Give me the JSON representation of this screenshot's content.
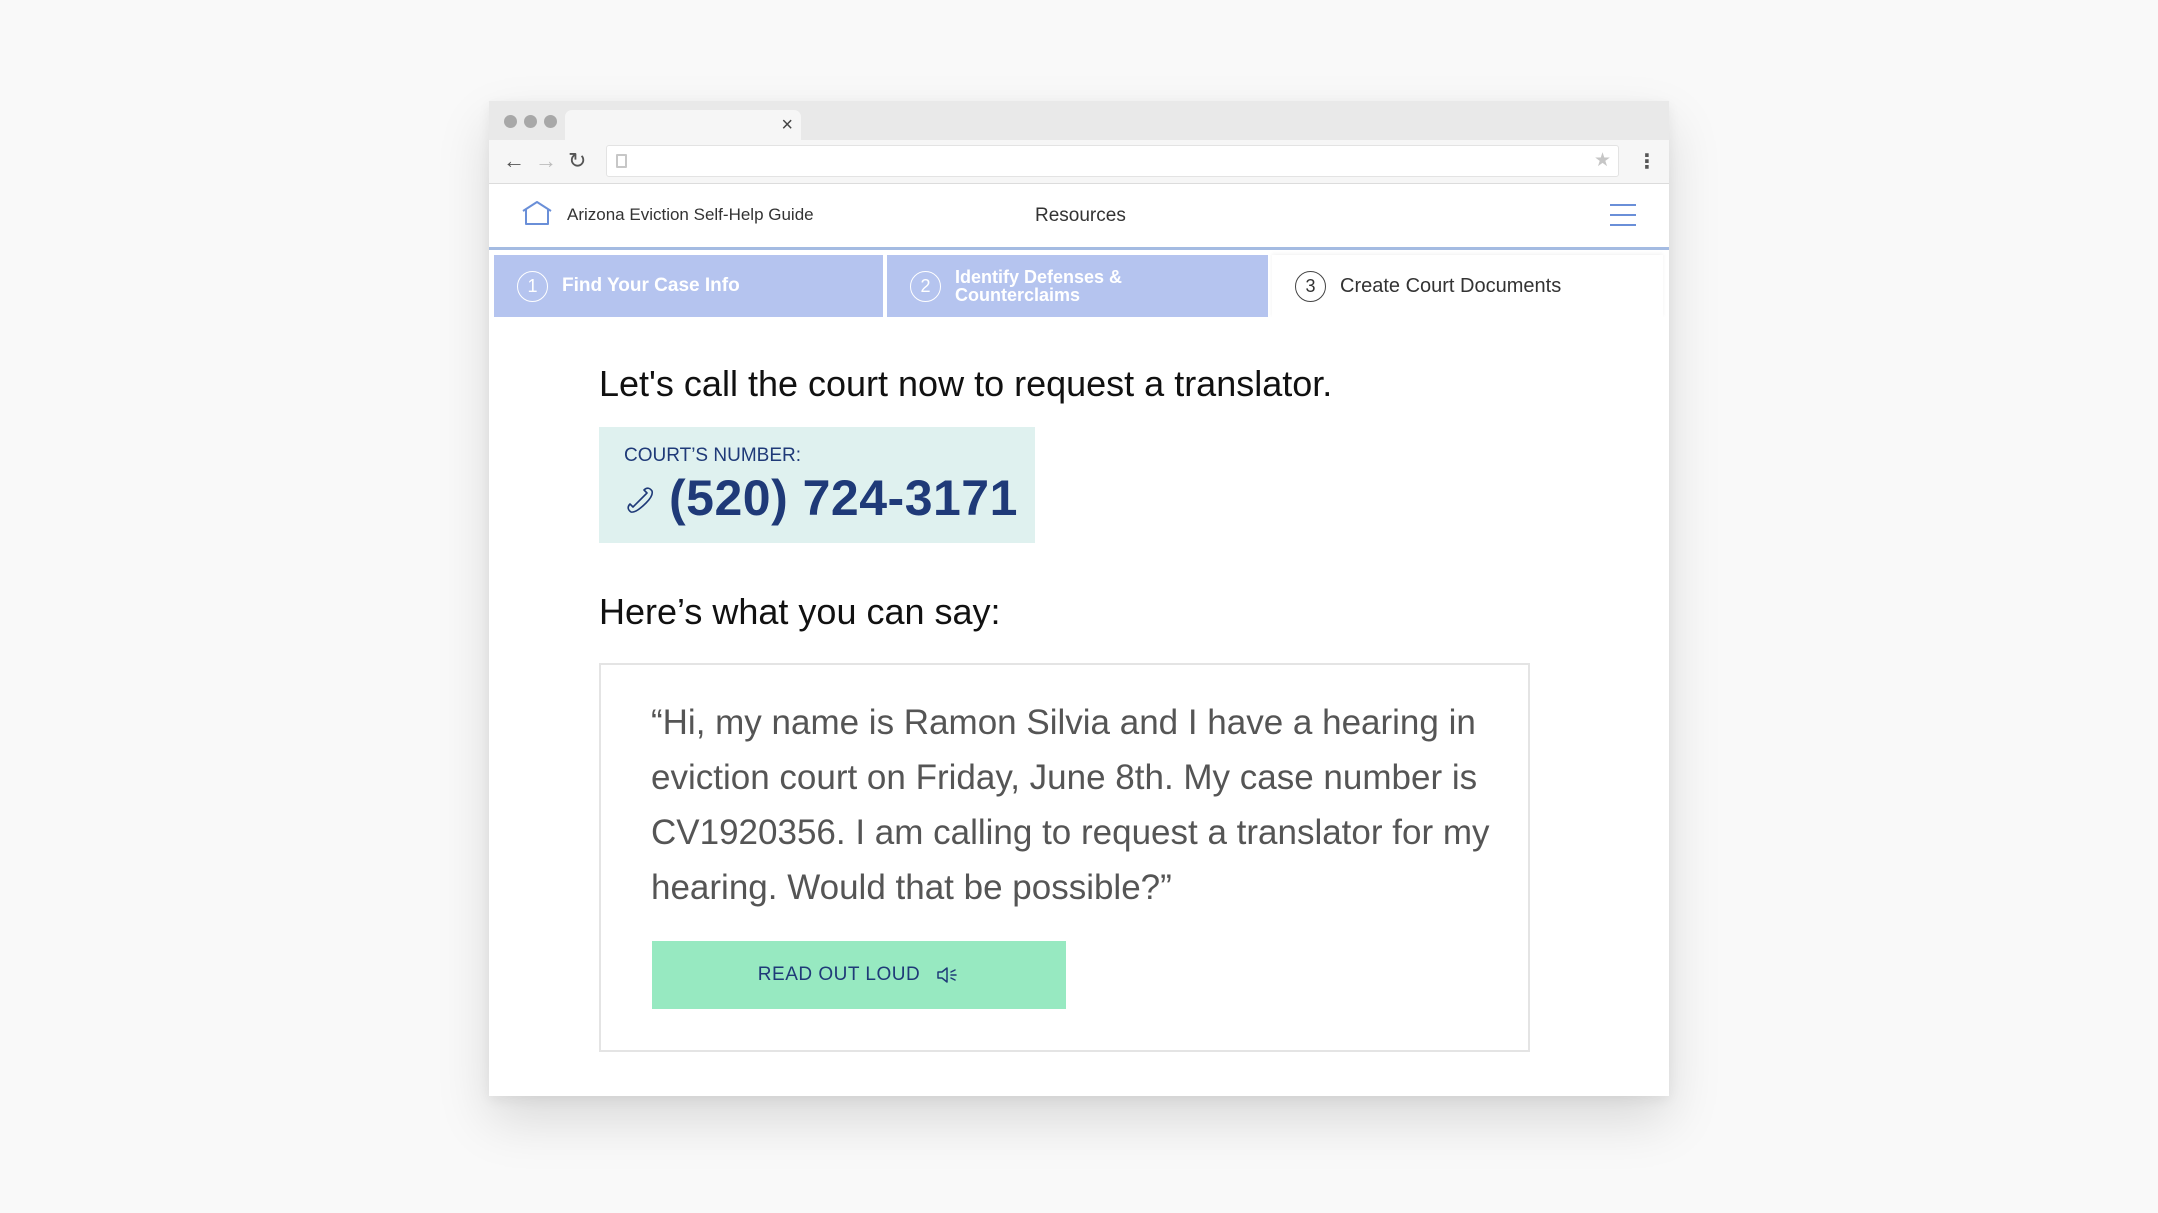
{
  "site": {
    "title": "Arizona Eviction Self-Help Guide",
    "nav_resources": "Resources"
  },
  "steps": [
    {
      "number": "1",
      "label": "Find Your Case Info",
      "state": "completed"
    },
    {
      "number": "2",
      "label": "Identify Defenses & Counterclaims",
      "state": "completed"
    },
    {
      "number": "3",
      "label": "Create Court Documents",
      "state": "active"
    }
  ],
  "main": {
    "headline": "Let's call the court now to request a translator.",
    "court_label": "COURT’S NUMBER:",
    "court_number": "(520) 724-3171",
    "subheading": "Here’s what you can say:",
    "script": "“Hi, my name is Ramon Silvia and I have a hearing in eviction court on Friday, June 8th. My case number is CV1920356. I am calling to request a translator for my hearing. Would that be possible?”",
    "read_button": "READ OUT LOUD"
  },
  "colors": {
    "accent_navy": "#1f3a78",
    "step_completed": "#b5c4ef",
    "court_box_bg": "#dff1ef",
    "button_bg": "#97e9c1"
  },
  "icons": [
    "home-icon",
    "hamburger-menu-icon",
    "phone-icon",
    "speaker-icon",
    "back-arrow-icon",
    "forward-arrow-icon",
    "reload-icon",
    "bookmark-star-icon"
  ]
}
